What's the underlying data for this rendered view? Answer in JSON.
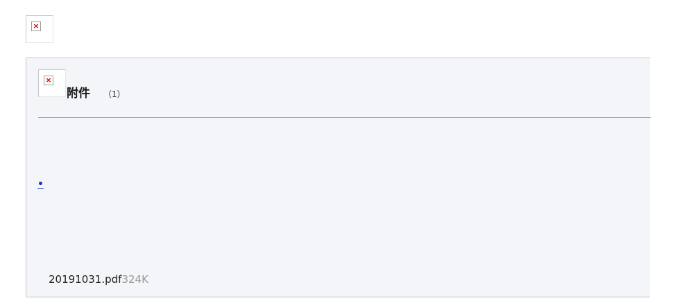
{
  "top_image": {
    "icon": "broken-image-icon",
    "glyph": "×"
  },
  "attachments": {
    "header_icon": {
      "icon": "broken-image-icon",
      "glyph": "×"
    },
    "title": "附件",
    "count": "（1）",
    "bullet": "•",
    "files": [
      {
        "name": "20191031.pdf",
        "size": "324K"
      }
    ]
  },
  "colors": {
    "panel_background": "#f3f5f9",
    "link": "#1a33cc",
    "muted_text": "#999999",
    "broken_icon_x": "#d40000"
  }
}
